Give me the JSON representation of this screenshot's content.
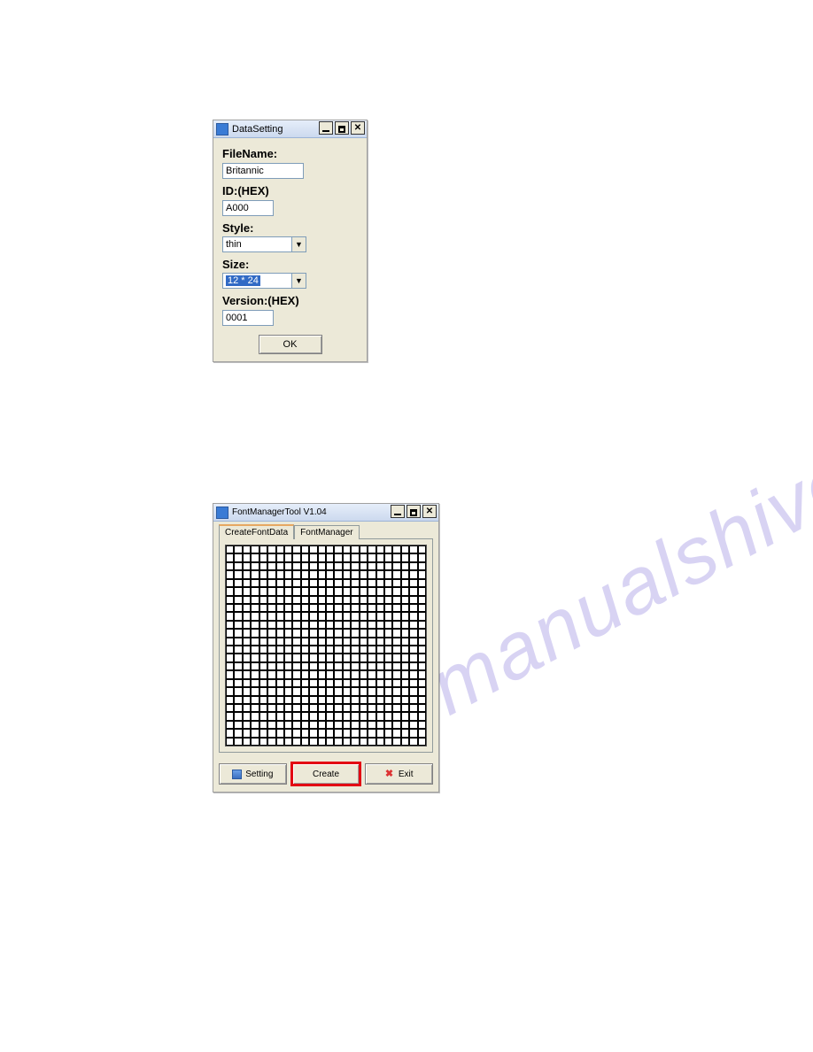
{
  "watermark": "manualshive.com",
  "dialog1": {
    "title": "DataSetting",
    "labels": {
      "fileName": "FileName:",
      "id": "ID:(HEX)",
      "style": "Style:",
      "size": "Size:",
      "version": "Version:(HEX)"
    },
    "values": {
      "fileName": "Britannic",
      "id": "A000",
      "style": "thin",
      "size": "12 * 24",
      "version": "0001"
    },
    "okLabel": "OK"
  },
  "dialog2": {
    "title": "FontManagerTool V1.04",
    "tabs": {
      "create": "CreateFontData",
      "manager": "FontManager"
    },
    "buttons": {
      "setting": "Setting",
      "create": "Create",
      "exit": "Exit"
    }
  }
}
